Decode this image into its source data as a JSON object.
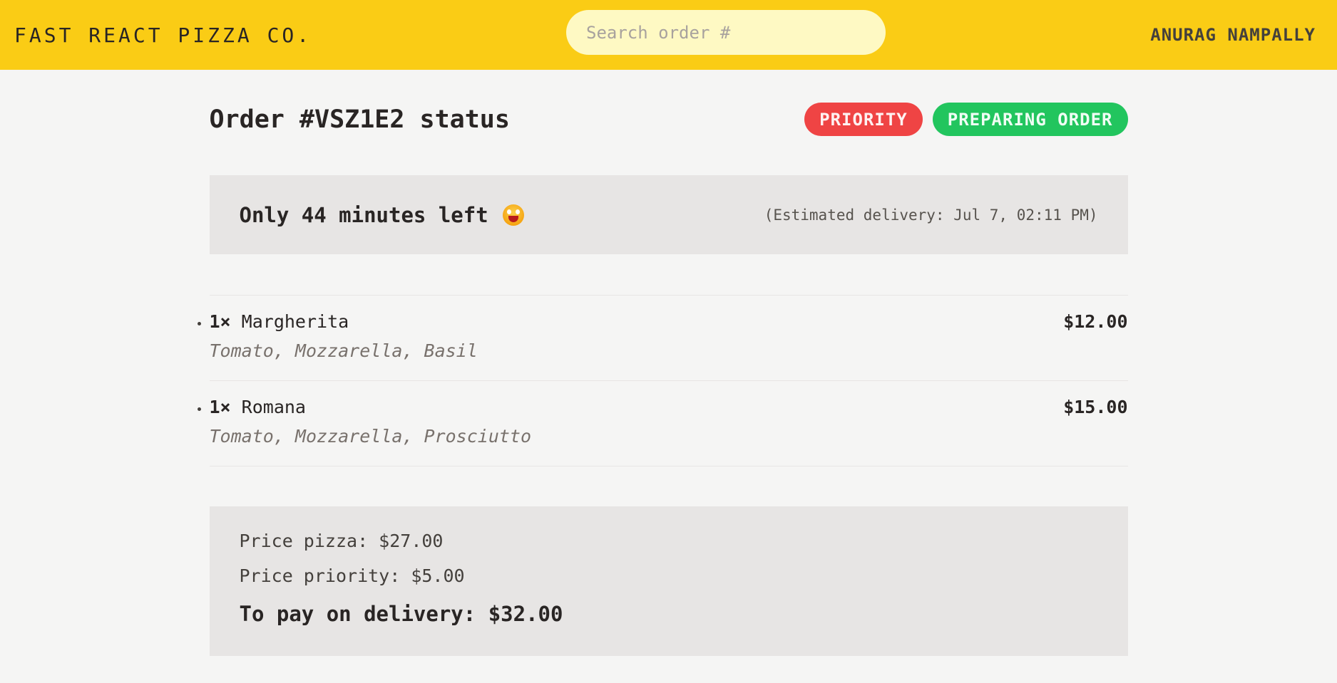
{
  "header": {
    "logo": "FAST REACT PIZZA CO.",
    "search_placeholder": "Search order #",
    "username": "ANURAG NAMPALLY",
    "bg_color": "#facc15"
  },
  "order": {
    "title": "Order #VSZ1E2 status",
    "badges": {
      "priority": "PRIORITY",
      "status": "PREPARING ORDER"
    },
    "eta": {
      "text": "Only 44 minutes left",
      "emoji_icon": "grinning-face-emoji",
      "estimated": "(Estimated delivery: Jul 7, 02:11 PM)"
    },
    "items": [
      {
        "quantity": "1×",
        "name": "Margherita",
        "price": "$12.00",
        "ingredients": "Tomato, Mozzarella, Basil"
      },
      {
        "quantity": "1×",
        "name": "Romana",
        "price": "$15.00",
        "ingredients": "Tomato, Mozzarella, Prosciutto"
      }
    ],
    "summary": {
      "price_pizza": "Price pizza: $27.00",
      "price_priority": "Price priority: $5.00",
      "total": "To pay on delivery: $32.00"
    }
  },
  "colors": {
    "priority": "#ef4444",
    "status": "#22c55e",
    "panel": "#e7e5e4",
    "background": "#f5f5f4"
  }
}
